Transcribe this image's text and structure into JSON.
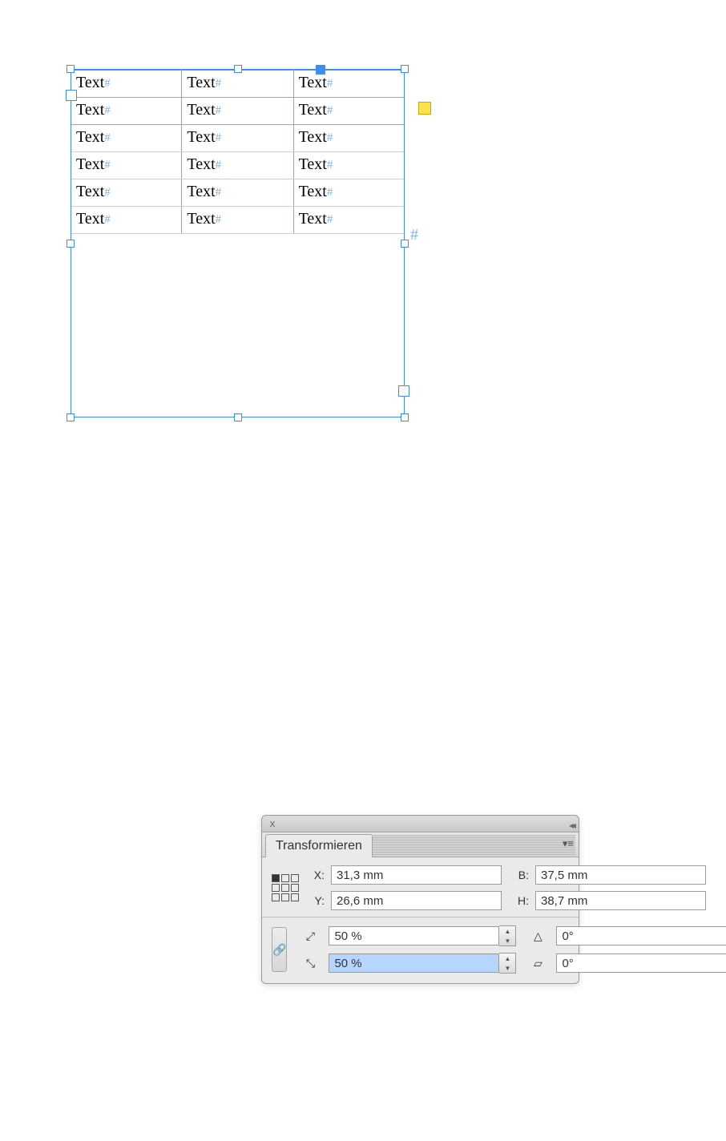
{
  "table": {
    "cell_text": "Text",
    "pilcrow": "#",
    "rows": 6,
    "cols": 3
  },
  "story_end_marker": "#",
  "panel": {
    "title": "Transformieren",
    "labels": {
      "x": "X:",
      "y": "Y:",
      "w": "B:",
      "h": "H:"
    },
    "values": {
      "x": "31,3 mm",
      "y": "26,6 mm",
      "w": "37,5 mm",
      "h": "38,7 mm",
      "scale_x": "50 %",
      "scale_y": "50 %",
      "rotate": "0°",
      "shear": "0°"
    },
    "icons": {
      "close": "x",
      "collapse": "◂◂",
      "flyout": "▾≡",
      "scale_x": "⤢",
      "scale_y": "⤡",
      "rotate": "△",
      "shear": "▱",
      "link": "🔗"
    }
  }
}
